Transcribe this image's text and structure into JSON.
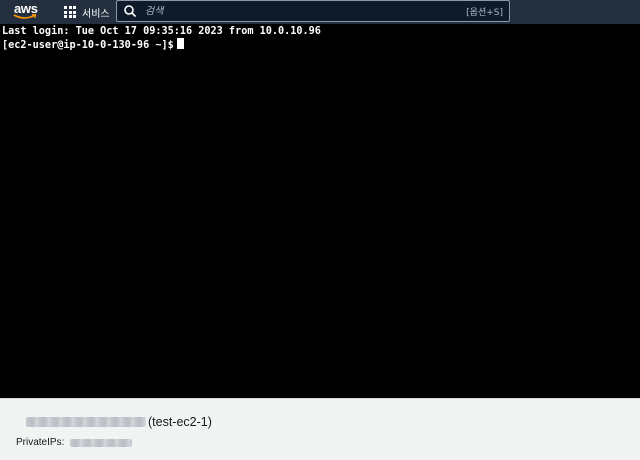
{
  "topbar": {
    "logo_text": "aws",
    "services_label": "서비스",
    "search_placeholder": "검색",
    "search_shortcut": "[옵션+S]"
  },
  "terminal": {
    "lines": [
      "Last login: Tue Oct 17 09:35:16 2023 from 10.0.10.96",
      "[ec2-user@ip-10-0-130-96 ~]$"
    ]
  },
  "instance_panel": {
    "instance_name": "(test-ec2-1)",
    "private_ips_label": "PrivateIPs:"
  },
  "colors": {
    "nav_bg": "#232f3e",
    "terminal_bg": "#000000",
    "panel_bg": "#f2f3f3",
    "aws_smile": "#ff9900"
  },
  "icons": {
    "logo": "aws-logo",
    "services": "grid-icon",
    "search": "search-icon"
  }
}
